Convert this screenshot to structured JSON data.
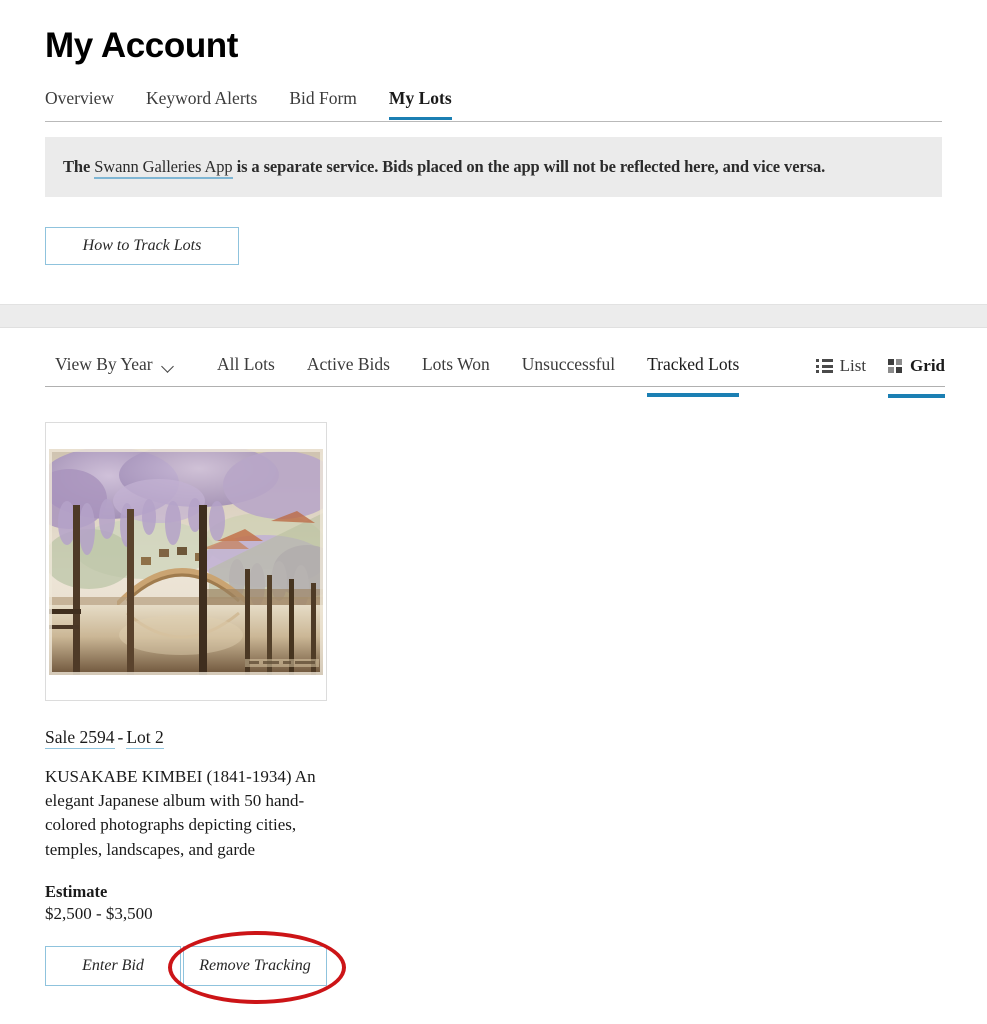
{
  "header": {
    "title": "My Account"
  },
  "account_tabs": [
    {
      "label": "Overview",
      "active": false
    },
    {
      "label": "Keyword Alerts",
      "active": false
    },
    {
      "label": "Bid Form",
      "active": false
    },
    {
      "label": "My Lots",
      "active": true
    }
  ],
  "notice": {
    "prefix": "The ",
    "link_label": "Swann Galleries App",
    "suffix": " is a separate service. Bids placed on the app will not be reflected here, and vice versa."
  },
  "how_to_button": {
    "label": "How to Track Lots"
  },
  "filter_bar": {
    "view_by_year_label": "View By Year",
    "chevron_icon": "chevron-down-icon",
    "tabs": [
      {
        "label": "All Lots",
        "active": false
      },
      {
        "label": "Active Bids",
        "active": false
      },
      {
        "label": "Lots Won",
        "active": false
      },
      {
        "label": "Unsuccessful",
        "active": false
      },
      {
        "label": "Tracked Lots",
        "active": true
      }
    ],
    "view_modes": [
      {
        "label": "List",
        "icon": "list-view-icon",
        "active": false
      },
      {
        "label": "Grid",
        "icon": "grid-view-icon",
        "active": true
      }
    ]
  },
  "lot": {
    "sale_link": "Sale 2594",
    "separator": "-",
    "lot_link": "Lot 2",
    "description": "KUSAKABE KIMBEI (1841-1934) An elegant Japanese album with 50 hand-colored photographs depicting cities, temples, landscapes, and garde",
    "estimate_label": "Estimate",
    "estimate_value": "$2,500 - $3,500",
    "enter_bid_label": "Enter Bid",
    "remove_tracking_label": "Remove Tracking",
    "thumbnail_alt": "hand-colored photograph of wisteria garden with arched bridge reflected in water"
  },
  "annotation": {
    "shape": "ellipse",
    "color": "#cc1417",
    "targets": "remove-tracking-button"
  },
  "colors": {
    "accent_blue": "#1b7fb3",
    "border_blue": "#8fc3dd",
    "notice_bg": "#ebebeb",
    "band_gray": "#ececec",
    "annotation_red": "#cc1417"
  }
}
